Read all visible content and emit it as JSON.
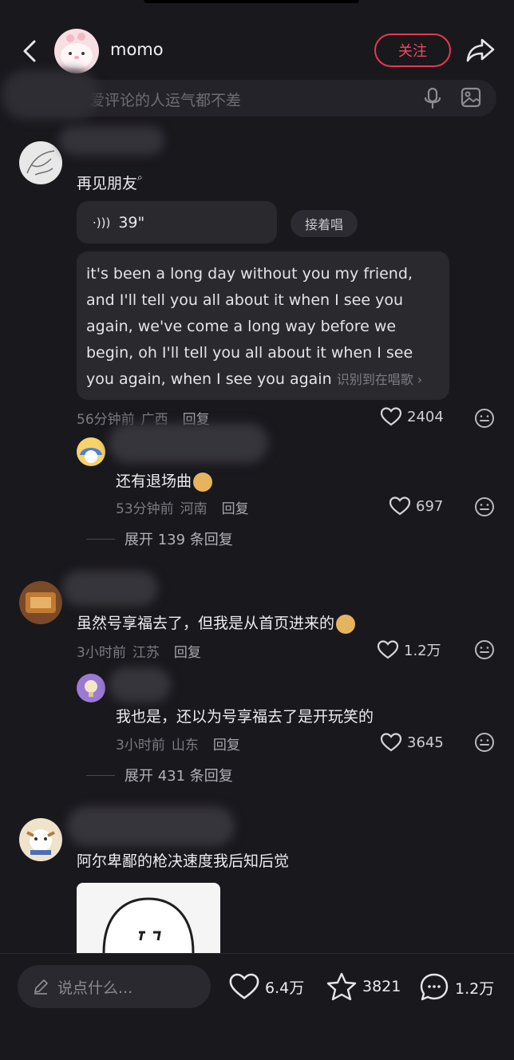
{
  "header": {
    "username": "momo",
    "follow_label": "关注",
    "search_placeholder": "爱评论的人运气都不差"
  },
  "comments": [
    {
      "text": "再见朋友",
      "voice_duration": "39\"",
      "sing_along_label": "接着唱",
      "lyrics": "it's been a long day without you my friend, and I'll tell you all about it when I see you again, we've come a long way before we begin, oh I'll tell you all about it when I see you again, when I see you again",
      "recognize_label": "识别到在唱歌",
      "time": "56分钟前",
      "location": "广西",
      "reply_label": "回复",
      "likes": "2404",
      "reply": {
        "text": "还有退场曲",
        "time": "53分钟前",
        "location": "河南",
        "reply_label": "回复",
        "likes": "697"
      },
      "expand_label": "展开 139 条回复"
    },
    {
      "text": "虽然号享福去了，但我是从首页进来的",
      "time": "3小时前",
      "location": "江苏",
      "reply_label": "回复",
      "likes": "1.2万",
      "reply": {
        "text": "我也是，还以为号享福去了是开玩笑的",
        "time": "3小时前",
        "location": "山东",
        "reply_label": "回复",
        "likes": "3645"
      },
      "expand_label": "展开 431 条回复"
    },
    {
      "text": "阿尔卑鄙的枪决速度我后知后觉"
    }
  ],
  "bottom_bar": {
    "input_placeholder": "说点什么...",
    "likes": "6.4万",
    "stars": "3821",
    "comments": "1.2万"
  },
  "colors": {
    "background": "#19181d",
    "accent_red": "#e8384f",
    "muted": "#7b7a80"
  }
}
